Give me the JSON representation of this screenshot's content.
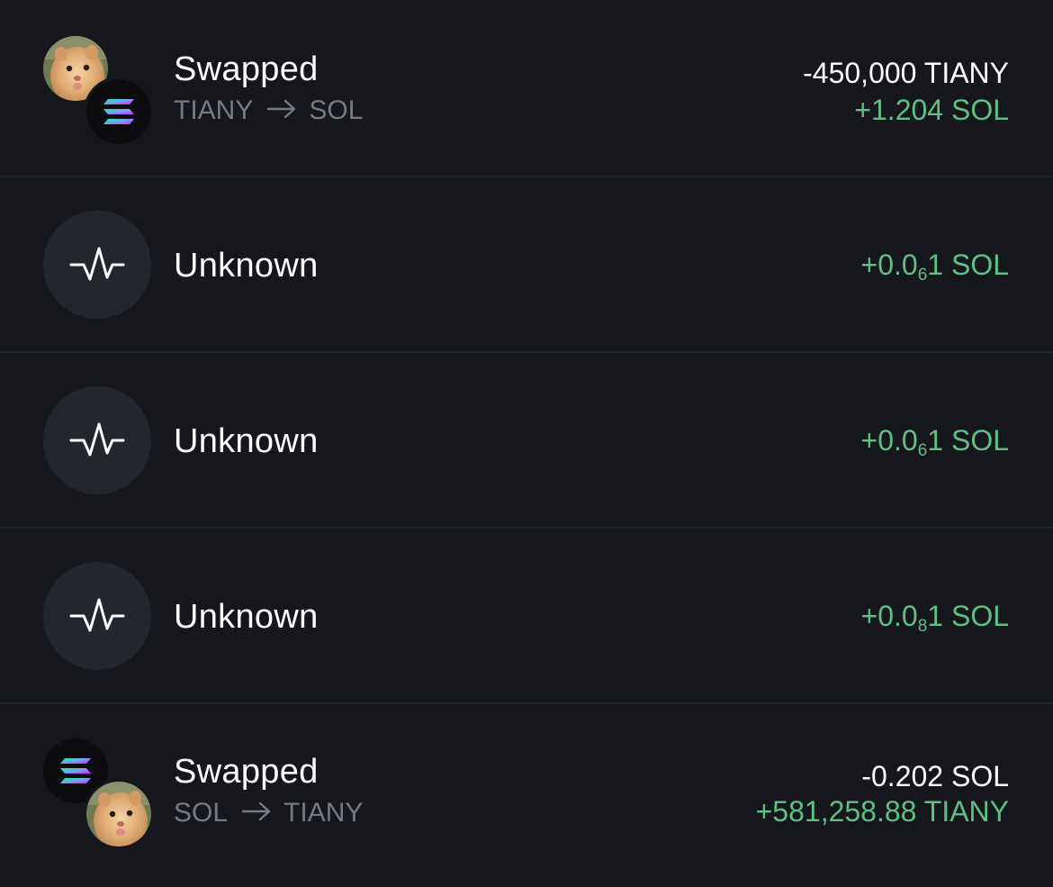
{
  "colors": {
    "background": "#16171c",
    "divider": "#22242b",
    "icon_circle": "#24262d",
    "positive": "#5fbf84",
    "negative_text": "#ffffff",
    "muted": "#777a83"
  },
  "transactions": [
    {
      "type": "swap",
      "title": "Swapped",
      "from_token": "TIANY",
      "to_token": "SOL",
      "arrow_icon": "arrow-right-icon",
      "amount_out": "-450,000 TIANY",
      "amount_in": "+1.204 SOL",
      "primary_coin": "tiany-hamster-icon",
      "secondary_coin": "solana-icon"
    },
    {
      "type": "unknown",
      "title": "Unknown",
      "icon": "activity-pulse-icon",
      "amount_prefix": "+0.0",
      "amount_subscript": "6",
      "amount_suffix": "1 SOL"
    },
    {
      "type": "unknown",
      "title": "Unknown",
      "icon": "activity-pulse-icon",
      "amount_prefix": "+0.0",
      "amount_subscript": "6",
      "amount_suffix": "1 SOL"
    },
    {
      "type": "unknown",
      "title": "Unknown",
      "icon": "activity-pulse-icon",
      "amount_prefix": "+0.0",
      "amount_subscript": "8",
      "amount_suffix": "1 SOL"
    },
    {
      "type": "swap",
      "title": "Swapped",
      "from_token": "SOL",
      "to_token": "TIANY",
      "arrow_icon": "arrow-right-icon",
      "amount_out": "-0.202 SOL",
      "amount_in": "+581,258.88 TIANY",
      "primary_coin": "solana-icon",
      "secondary_coin": "tiany-hamster-icon"
    }
  ]
}
